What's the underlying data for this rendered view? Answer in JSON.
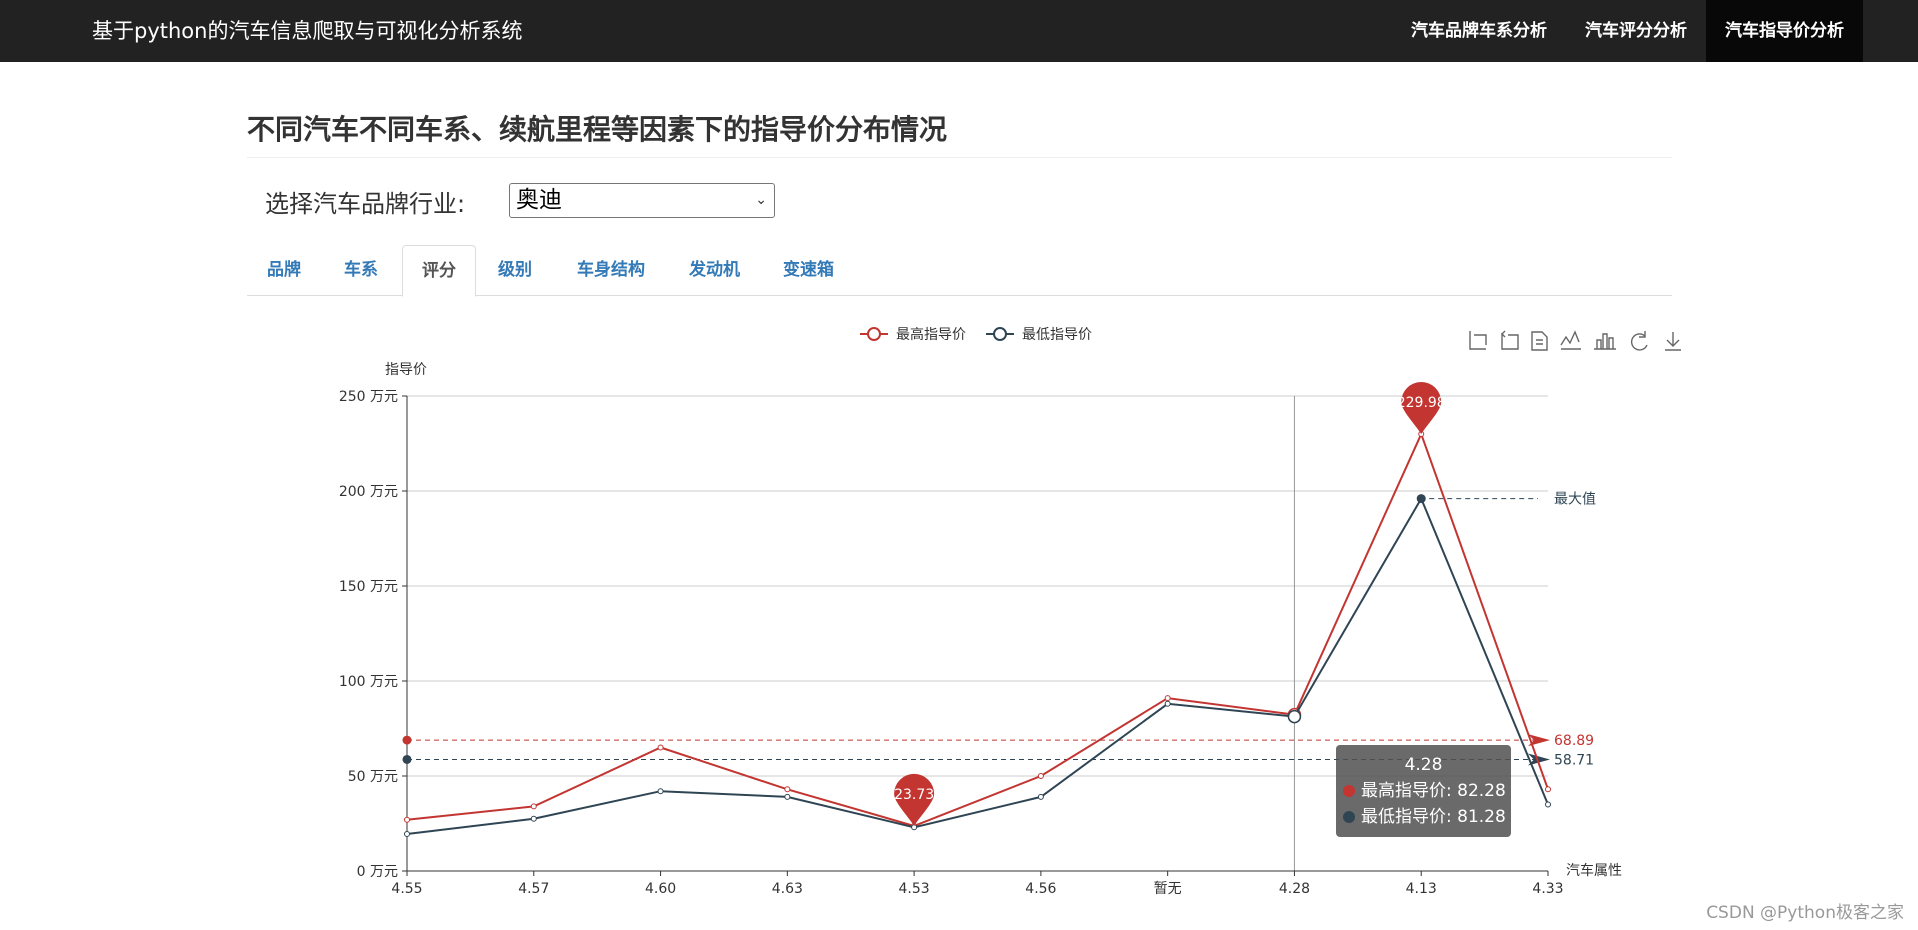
{
  "navbar": {
    "brand": "基于python的汽车信息爬取与可视化分析系统",
    "items": [
      "汽车品牌车系分析",
      "汽车评分分析",
      "汽车指导价分析"
    ],
    "active_index": 2
  },
  "page": {
    "title": "不同汽车不同车系、续航里程等因素下的指导价分布情况",
    "select_label": "选择汽车品牌行业:",
    "select_value": "奥迪"
  },
  "tabs": {
    "items": [
      "品牌",
      "车系",
      "评分",
      "级别",
      "车身结构",
      "发动机",
      "变速箱"
    ],
    "active_index": 2
  },
  "toolbox": {
    "icons": [
      "data-zoom-icon",
      "zoom-reset-icon",
      "data-view-icon",
      "line-chart-icon",
      "bar-chart-icon",
      "restore-icon",
      "save-image-icon"
    ]
  },
  "chart_data": {
    "type": "line",
    "categories": [
      "4.55",
      "4.57",
      "4.60",
      "4.63",
      "4.53",
      "4.56",
      "暂无",
      "4.28",
      "4.13",
      "4.33"
    ],
    "xlabel": "汽车属性",
    "ylabel": "指导价",
    "ytick_suffix": " 万元",
    "ylim": [
      0,
      250
    ],
    "yticks": [
      0,
      50,
      100,
      150,
      200,
      250
    ],
    "grid": true,
    "legend_position": "top",
    "series": [
      {
        "name": "最高指导价",
        "color": "#c23531",
        "values": [
          27,
          34,
          65,
          43,
          23.73,
          50,
          91,
          82.28,
          229.98,
          43
        ]
      },
      {
        "name": "最低指导价",
        "color": "#2f4554",
        "values": [
          19.5,
          27.5,
          42,
          39,
          23,
          39,
          88,
          81.28,
          196,
          35
        ]
      }
    ],
    "mark_points": [
      {
        "label": "229.98",
        "category_index": 8,
        "value": 229.98
      },
      {
        "label": "23.73",
        "category_index": 4,
        "value": 23.73
      }
    ],
    "mark_lines": [
      {
        "label": "68.89",
        "value": 68.89,
        "color": "#c23531"
      },
      {
        "label": "58.71",
        "value": 58.71,
        "color": "#2f4554"
      },
      {
        "label": "最大值",
        "value": 196,
        "color": "#2f4554"
      }
    ],
    "tooltip": {
      "category_index": 7,
      "title": "4.28",
      "rows": [
        {
          "name": "最高指导价",
          "value": "82.28",
          "color": "#c23531"
        },
        {
          "name": "最低指导价",
          "value": "81.28",
          "color": "#2f4554"
        }
      ]
    }
  },
  "watermark": "CSDN @Python极客之家"
}
